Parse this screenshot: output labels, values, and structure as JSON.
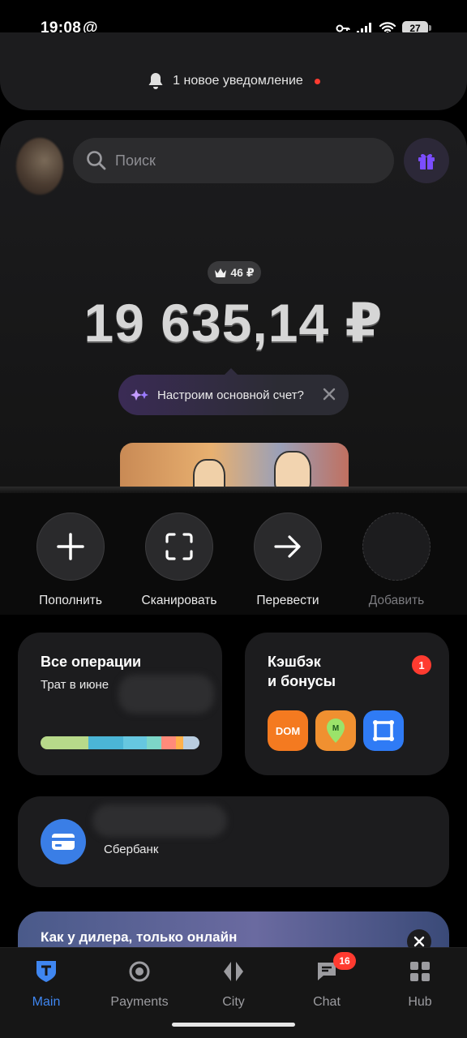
{
  "status_bar": {
    "time": "19:08",
    "at_symbol": "@",
    "battery": "27"
  },
  "notification": {
    "text": "1 новое уведомление"
  },
  "header": {
    "search_placeholder": "Поиск"
  },
  "balance": {
    "cashback_chip": "46 ₽",
    "amount": "19 635,14 ₽"
  },
  "tip": {
    "text": "Настроим основной счет?"
  },
  "actions": [
    {
      "label": "Пополнить",
      "icon": "plus-icon"
    },
    {
      "label": "Сканировать",
      "icon": "scan-icon"
    },
    {
      "label": "Перевести",
      "icon": "arrow-right-icon"
    },
    {
      "label": "Добавить",
      "icon": "placeholder-icon"
    }
  ],
  "operations_tile": {
    "title": "Все операции",
    "subtitle": "Трат в июне",
    "spend_segments": [
      0.3,
      0.22,
      0.15,
      0.09,
      0.09,
      0.05,
      0.1
    ],
    "spend_colors": [
      "#b7d98a",
      "#4bb5d6",
      "#66c7e0",
      "#7dd6c8",
      "#ff8a7a",
      "#ffb04a",
      "#b9cde0"
    ]
  },
  "cashback_tile": {
    "title_line1": "Кэшбэк",
    "title_line2": "и бонусы",
    "badge": "1",
    "partners": [
      {
        "name": "DOM",
        "color": "#f47a20"
      },
      {
        "name": "М",
        "color": "#f09030"
      },
      {
        "name": "app",
        "color": "#2f7bf5"
      }
    ]
  },
  "bank_tile": {
    "name": "Сбербанк"
  },
  "banner": {
    "text": "Как у дилера, только онлайн"
  },
  "tabs": [
    {
      "label": "Main",
      "icon": "bank-t-icon",
      "active": true
    },
    {
      "label": "Payments",
      "icon": "payments-icon",
      "active": false
    },
    {
      "label": "City",
      "icon": "city-icon",
      "active": false
    },
    {
      "label": "Chat",
      "icon": "chat-icon",
      "active": false,
      "badge": "16"
    },
    {
      "label": "Hub",
      "icon": "hub-grid-icon",
      "active": false
    }
  ]
}
